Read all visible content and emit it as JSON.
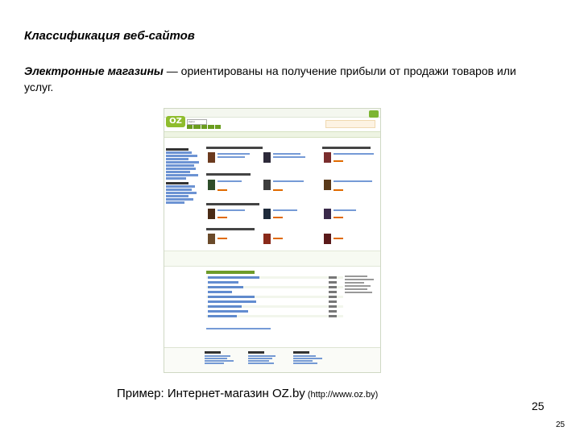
{
  "slide": {
    "heading": "Классификация веб-сайтов",
    "paragraph_bold": "Электронные магазины",
    "paragraph_rest": " — ориентированы на получение прибыли от продажи товаров или услуг.",
    "caption_main": "Пример: Интернет-магазин OZ.by",
    "caption_url": " (http://www.oz.by)",
    "page_number": "25",
    "page_number_small": "25"
  },
  "screenshot": {
    "logo_text": "OZ",
    "search_value": "Книги",
    "colors": {
      "brand_green": "#8fbd2d",
      "nav_green": "#6a9d1f",
      "link_blue": "#3b6fc4",
      "price_orange": "#e06a00"
    }
  }
}
